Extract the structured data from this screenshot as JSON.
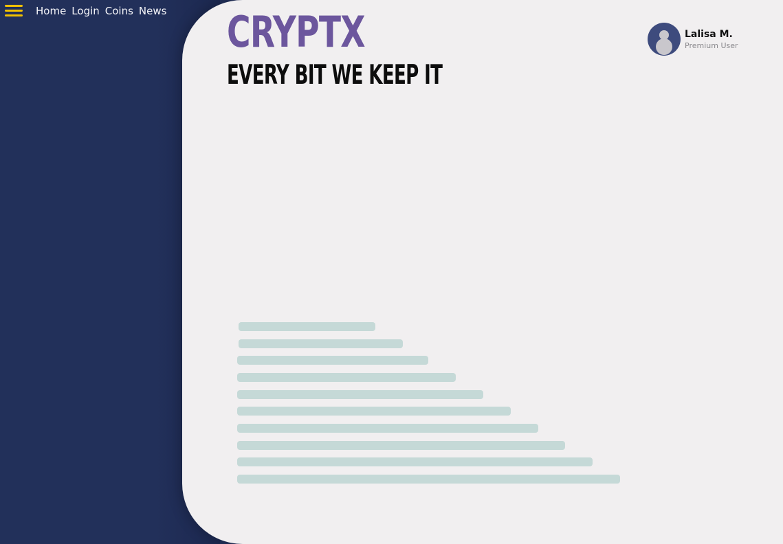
{
  "nav": {
    "menu_icon": "hamburger-icon",
    "links": [
      "Home",
      "Login",
      "Coins",
      "News"
    ]
  },
  "brand": {
    "name": "CRYPTX",
    "tagline": "EVERY BIT WE KEEP IT"
  },
  "user": {
    "name": "Lalisa M.",
    "role": "Premium User",
    "avatar_icon": "user-avatar-icon"
  },
  "colors": {
    "sidebar_bg": "#22305a",
    "panel_bg": "#f1eff0",
    "brand": "#6c569d",
    "menu_icon": "#f2c200",
    "skeleton_bar": "#c5d9d7",
    "avatar_bg": "#3e4b7d"
  },
  "loading_placeholder": {
    "line_count": 10
  }
}
